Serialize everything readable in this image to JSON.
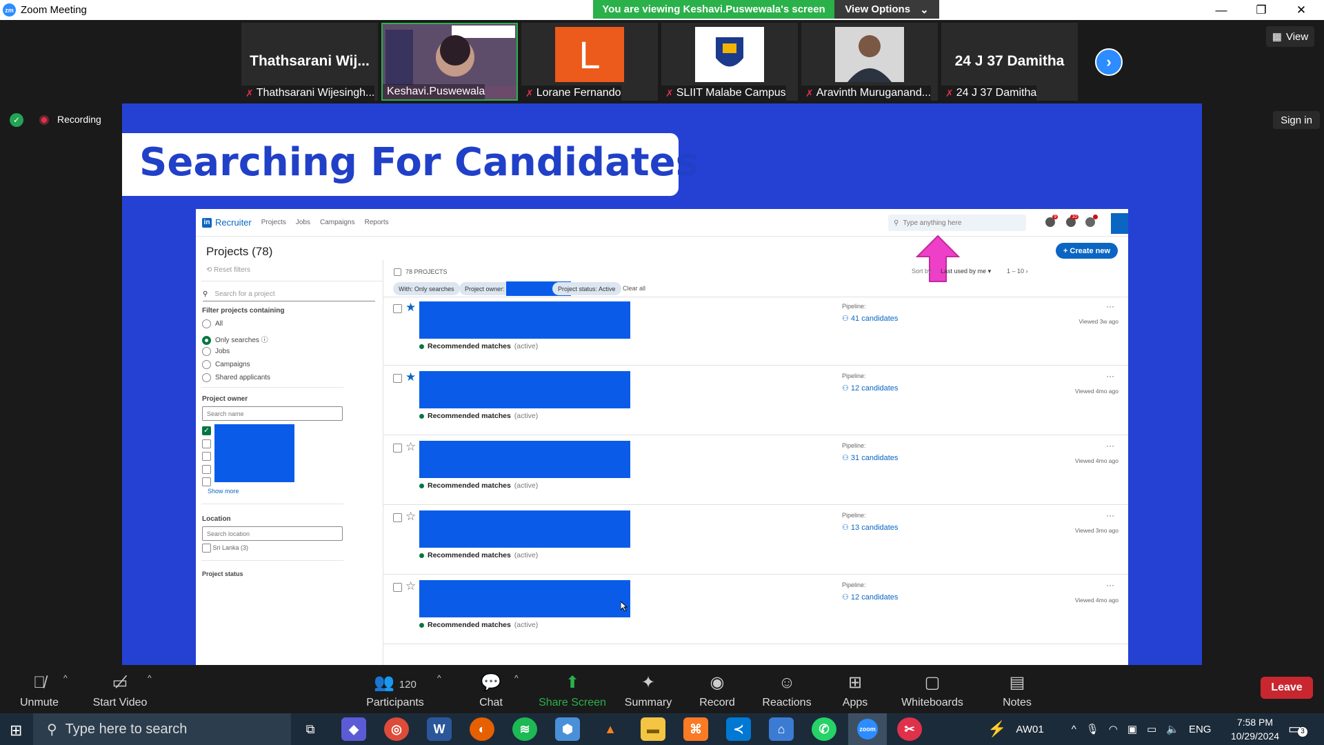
{
  "window": {
    "title": "Zoom Meeting",
    "viewing_banner": "You are viewing Keshavi.Puswewala's screen",
    "view_options": "View Options"
  },
  "gallery": {
    "tiles": [
      {
        "display": "Thathsarani  Wij...",
        "label": "Thathsarani Wijesingh..."
      },
      {
        "display": "",
        "label": "Keshavi.Puswewala"
      },
      {
        "display": "L",
        "label": "Lorane Fernando"
      },
      {
        "display": "",
        "label": "SLIIT Malabe Campus"
      },
      {
        "display": "",
        "label": "Aravinth Muruganand..."
      },
      {
        "display": "24 J 37 Damitha",
        "label": "24 J 37 Damitha"
      }
    ],
    "view_button": "View",
    "recording": "Recording",
    "sign_in": "Sign in"
  },
  "slide": {
    "title": "Searching For Candidates"
  },
  "recruiter": {
    "brand": "Recruiter",
    "nav": [
      "Projects",
      "Jobs",
      "Campaigns",
      "Reports"
    ],
    "search_placeholder": "Type anything here",
    "badges": {
      "messages": "9",
      "notifications": "10"
    },
    "page_title": "Projects (78)",
    "create_new": "+ Create new",
    "reset_filters": "Reset filters",
    "search_project_placeholder": "Search for a project",
    "filter_heading": "Filter projects containing",
    "filters": [
      {
        "label": "All",
        "selected": false
      },
      {
        "label": "Only searches",
        "selected": true
      },
      {
        "label": "Jobs",
        "selected": false
      },
      {
        "label": "Campaigns",
        "selected": false
      },
      {
        "label": "Shared applicants",
        "selected": false
      }
    ],
    "project_owner_heading": "Project owner",
    "search_name_placeholder": "Search name",
    "show_more": "Show more",
    "location_heading": "Location",
    "search_location_placeholder": "Search location",
    "location_option": "Sri Lanka (3)",
    "project_status_heading": "Project status",
    "projects_count": "78 PROJECTS",
    "chips": {
      "with": "With: Only searches",
      "owner": "Project owner:",
      "status": "Project status: Active",
      "clear": "Clear all"
    },
    "sort_by_label": "Sort by:",
    "sort_value": "Last used by me",
    "pagination": "1 – 10",
    "rows": [
      {
        "starred": true,
        "match": "Recommended matches",
        "state": "(active)",
        "pipeline": "Pipeline:",
        "candidates": "41 candidates",
        "viewed": "Viewed 3w ago"
      },
      {
        "starred": true,
        "match": "Recommended matches",
        "state": "(active)",
        "pipeline": "Pipeline:",
        "candidates": "12 candidates",
        "viewed": "Viewed 4mo ago"
      },
      {
        "starred": false,
        "match": "Recommended matches",
        "state": "(active)",
        "pipeline": "Pipeline:",
        "candidates": "31 candidates",
        "viewed": "Viewed 4mo ago"
      },
      {
        "starred": false,
        "match": "Recommended matches",
        "state": "(active)",
        "pipeline": "Pipeline:",
        "candidates": "13 candidates",
        "viewed": "Viewed 3mo ago"
      },
      {
        "starred": false,
        "match": "Recommended matches",
        "state": "(active)",
        "pipeline": "Pipeline:",
        "candidates": "12 candidates",
        "viewed": "Viewed 4mo ago"
      }
    ]
  },
  "controls": {
    "unmute": "Unmute",
    "start_video": "Start Video",
    "participants": "Participants",
    "participants_count": "120",
    "chat": "Chat",
    "share_screen": "Share Screen",
    "summary": "Summary",
    "record": "Record",
    "reactions": "Reactions",
    "apps": "Apps",
    "whiteboards": "Whiteboards",
    "notes": "Notes",
    "leave": "Leave"
  },
  "taskbar": {
    "search_placeholder": "Type here to search",
    "tray_app": "AW01",
    "language": "ENG",
    "time": "7:58 PM",
    "date": "10/29/2024",
    "notifications": "3"
  },
  "colors": {
    "slide_bg": "#2541d4",
    "share_green": "#2ab14a",
    "leave_red": "#c8272f",
    "zoom_blue": "#2d8cff",
    "linkedin_blue": "#0a66c2",
    "arrow_pink": "#ee3fc9"
  }
}
